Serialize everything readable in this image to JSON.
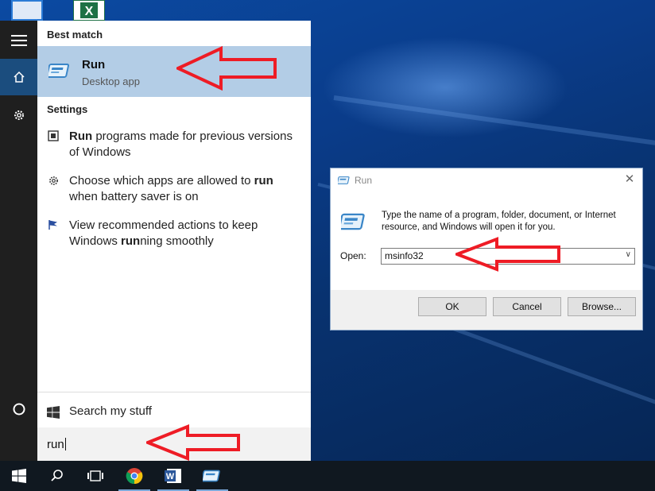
{
  "start_menu": {
    "best_match_heading": "Best match",
    "best_match": {
      "title": "Run",
      "subtitle": "Desktop app"
    },
    "settings_heading": "Settings",
    "settings": [
      {
        "bold": "Run",
        "rest": " programs made for previous versions of Windows",
        "icon": "compatibility-icon"
      },
      {
        "pre": "Choose which apps are allowed to ",
        "bold": "run",
        "rest": " when battery saver is on",
        "icon": "gear-icon"
      },
      {
        "pre": "View recommended actions to keep Windows ",
        "bold": "run",
        "rest": "ning smoothly",
        "icon": "flag-icon"
      }
    ],
    "search_my_stuff": "Search my stuff",
    "search_value": "run"
  },
  "run_dialog": {
    "title": "Run",
    "message": "Type the name of a program, folder, document, or Internet resource, and Windows will open it for you.",
    "open_label": "Open:",
    "open_value": "msinfo32",
    "ok": "OK",
    "cancel": "Cancel",
    "browse": "Browse..."
  },
  "colors": {
    "accent": "#1b4d7e",
    "best_match_bg": "#b3cde6",
    "annotation_red": "#ee1c25"
  }
}
